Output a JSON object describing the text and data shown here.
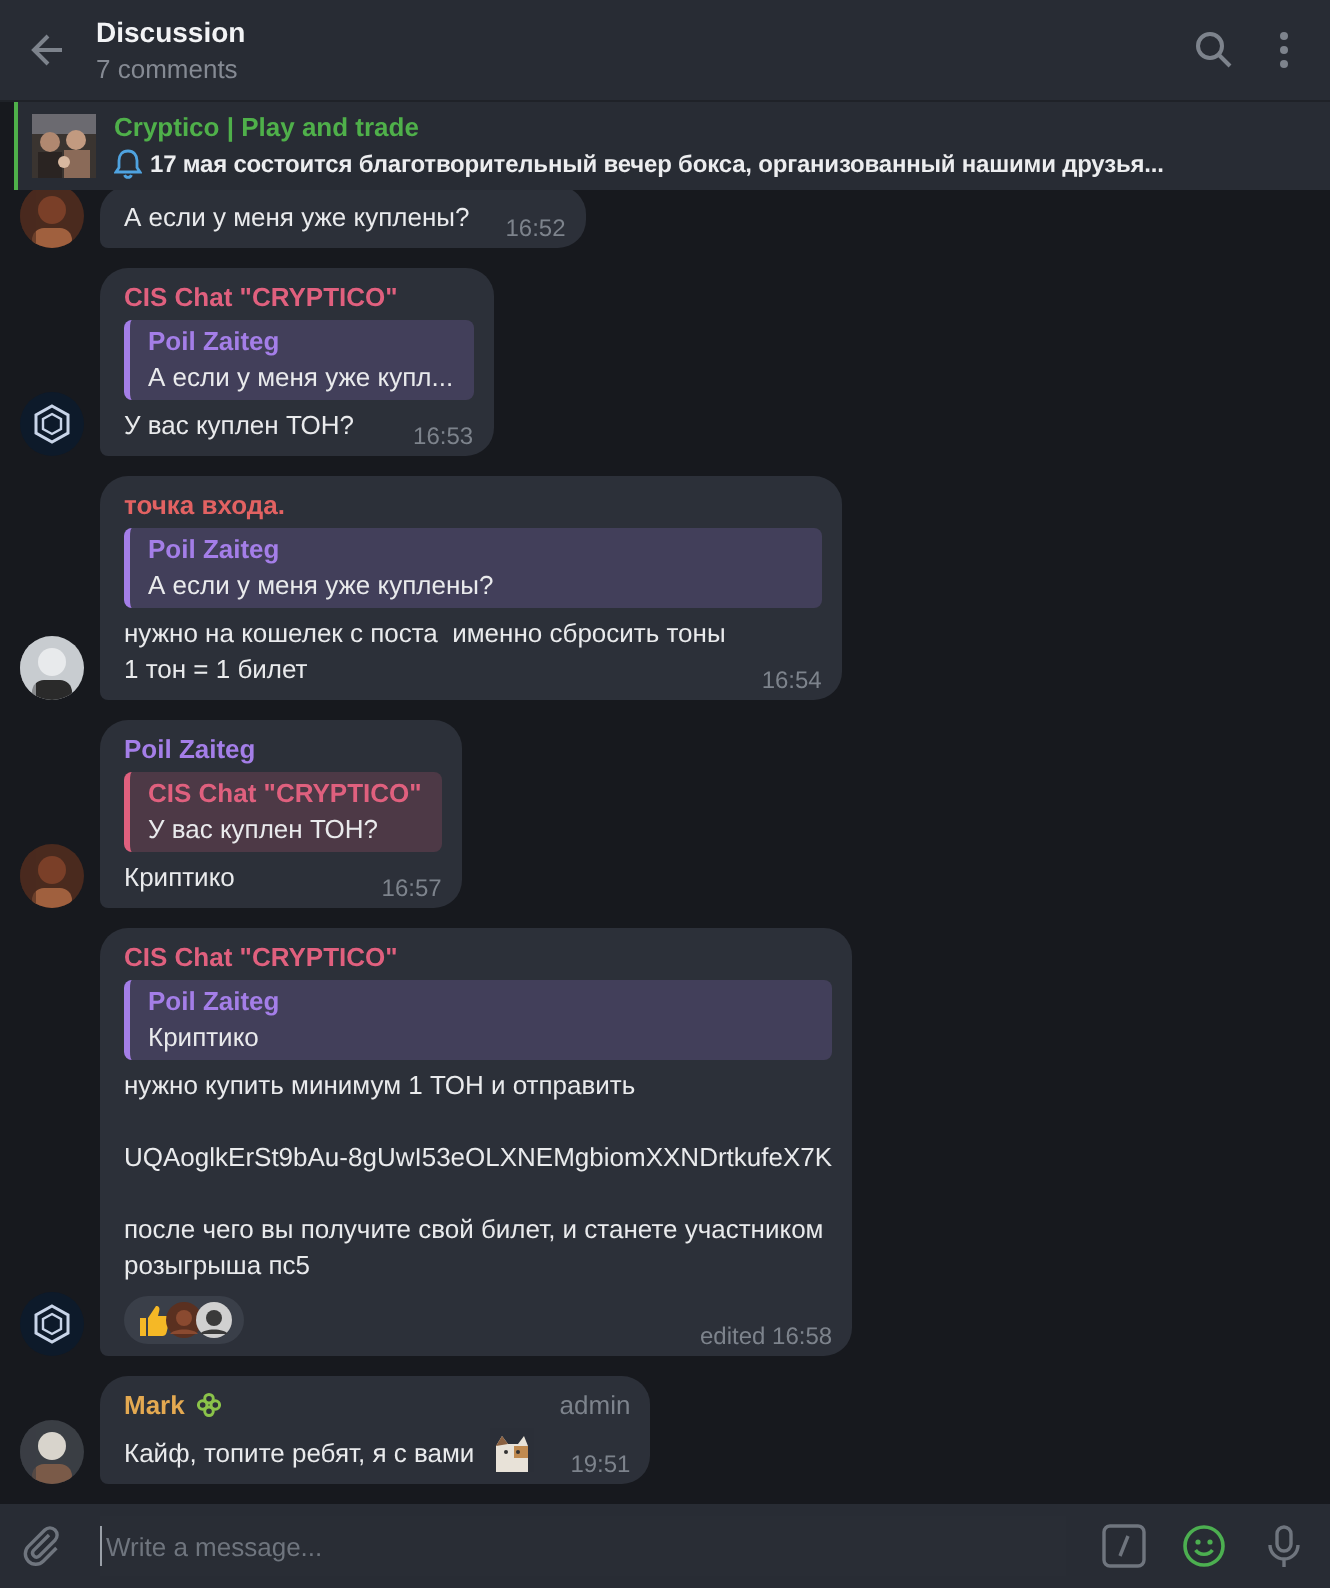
{
  "header": {
    "title": "Discussion",
    "subtitle": "7 comments"
  },
  "pinned": {
    "channel": "Cryptico | Play and trade",
    "text": "17 мая состоится благотворительный вечер бокса, организованный нашими друзья..."
  },
  "messages": [
    {
      "text": "А если у меня уже куплены?",
      "time": "16:52"
    },
    {
      "avatar": {
        "kind": "logo"
      },
      "sender": {
        "name": "CIS Chat \"CRYPTICO\"",
        "color": "#e0607e"
      },
      "reply": {
        "name": "Poil Zaiteg",
        "color": "#a47ee8",
        "text": "А если у меня уже купл..."
      },
      "text": "У вас куплен ТОН?",
      "time": "16:53"
    },
    {
      "sender": {
        "name": "точка входа.",
        "color": "#e26262"
      },
      "reply": {
        "name": "Poil Zaiteg",
        "color": "#a47ee8",
        "text": "А если у меня уже куплены?"
      },
      "text": "нужно на кошелек с поста  именно сбросить тоны\n1 тон = 1 билет",
      "time": "16:54"
    },
    {
      "sender": {
        "name": "Poil Zaiteg",
        "color": "#a47ee8"
      },
      "reply": {
        "name": "CIS Chat \"CRYPTICO\"",
        "color": "#e0607e",
        "text": "У вас куплен ТОН?"
      },
      "text": "Криптико",
      "time": "16:57"
    },
    {
      "avatar": {
        "kind": "logo"
      },
      "sender": {
        "name": "CIS Chat \"CRYPTICO\"",
        "color": "#e0607e"
      },
      "reply": {
        "name": "Poil Zaiteg",
        "color": "#a47ee8",
        "text": "Криптико"
      },
      "text": "нужно купить минимум 1 ТОН и отправить\n\nUQAoglkErSt9bAu-8gUwI53eOLXNEMgbiomXXNDrtkufeX7K\n\nпосле чего вы получите свой билет, и станете участником\nрозыгрыша пс5",
      "reactions": [
        {
          "kind": "emoji"
        },
        {
          "kind": "avatar"
        },
        {
          "kind": "avatar"
        }
      ],
      "time": "edited 16:58"
    },
    {
      "sender": {
        "name": "Mark",
        "color": "#e4a951",
        "status_icon": true
      },
      "badge": "admin",
      "text": "Кайф, топите ребят, я с вами",
      "sticker": true,
      "time": "19:51"
    }
  ],
  "composer": {
    "placeholder": "Write a message..."
  }
}
